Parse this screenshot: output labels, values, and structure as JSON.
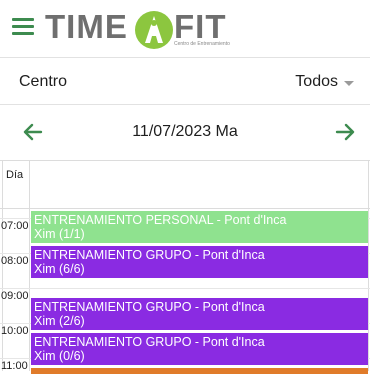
{
  "header": {
    "logo_text_left": "TIME",
    "logo_text_right": "FIT",
    "logo_subtitle": "Centro de Entrenamiento"
  },
  "filters": {
    "centro_label": "Centro",
    "todos_label": "Todos"
  },
  "date_nav": {
    "date_label": "11/07/2023 Ma"
  },
  "calendar": {
    "column_header": "Día",
    "times": [
      "07:00",
      "08:00",
      "09:00",
      "10:00",
      "11:00"
    ],
    "events": [
      {
        "title": "ENTRENAMIENTO PERSONAL - Pont d'Inca",
        "subtitle": "Xim (1/1)",
        "color": "#8fe28f"
      },
      {
        "title": "ENTRENAMIENTO GRUPO - Pont d'Inca",
        "subtitle": "Xim (6/6)",
        "color": "#8a2be2"
      },
      {
        "title": "ENTRENAMIENTO GRUPO - Pont d'Inca",
        "subtitle": "Xim (2/6)",
        "color": "#8a2be2"
      },
      {
        "title": "ENTRENAMIENTO GRUPO - Pont d'Inca",
        "subtitle": "Xim (0/6)",
        "color": "#8a2be2"
      },
      {
        "title": "",
        "subtitle": "",
        "color": "#e07b2a"
      }
    ]
  },
  "colors": {
    "brand_green": "#3d8b4f",
    "logo_green": "#8cc63f",
    "logo_gray": "#6f6f6f"
  }
}
